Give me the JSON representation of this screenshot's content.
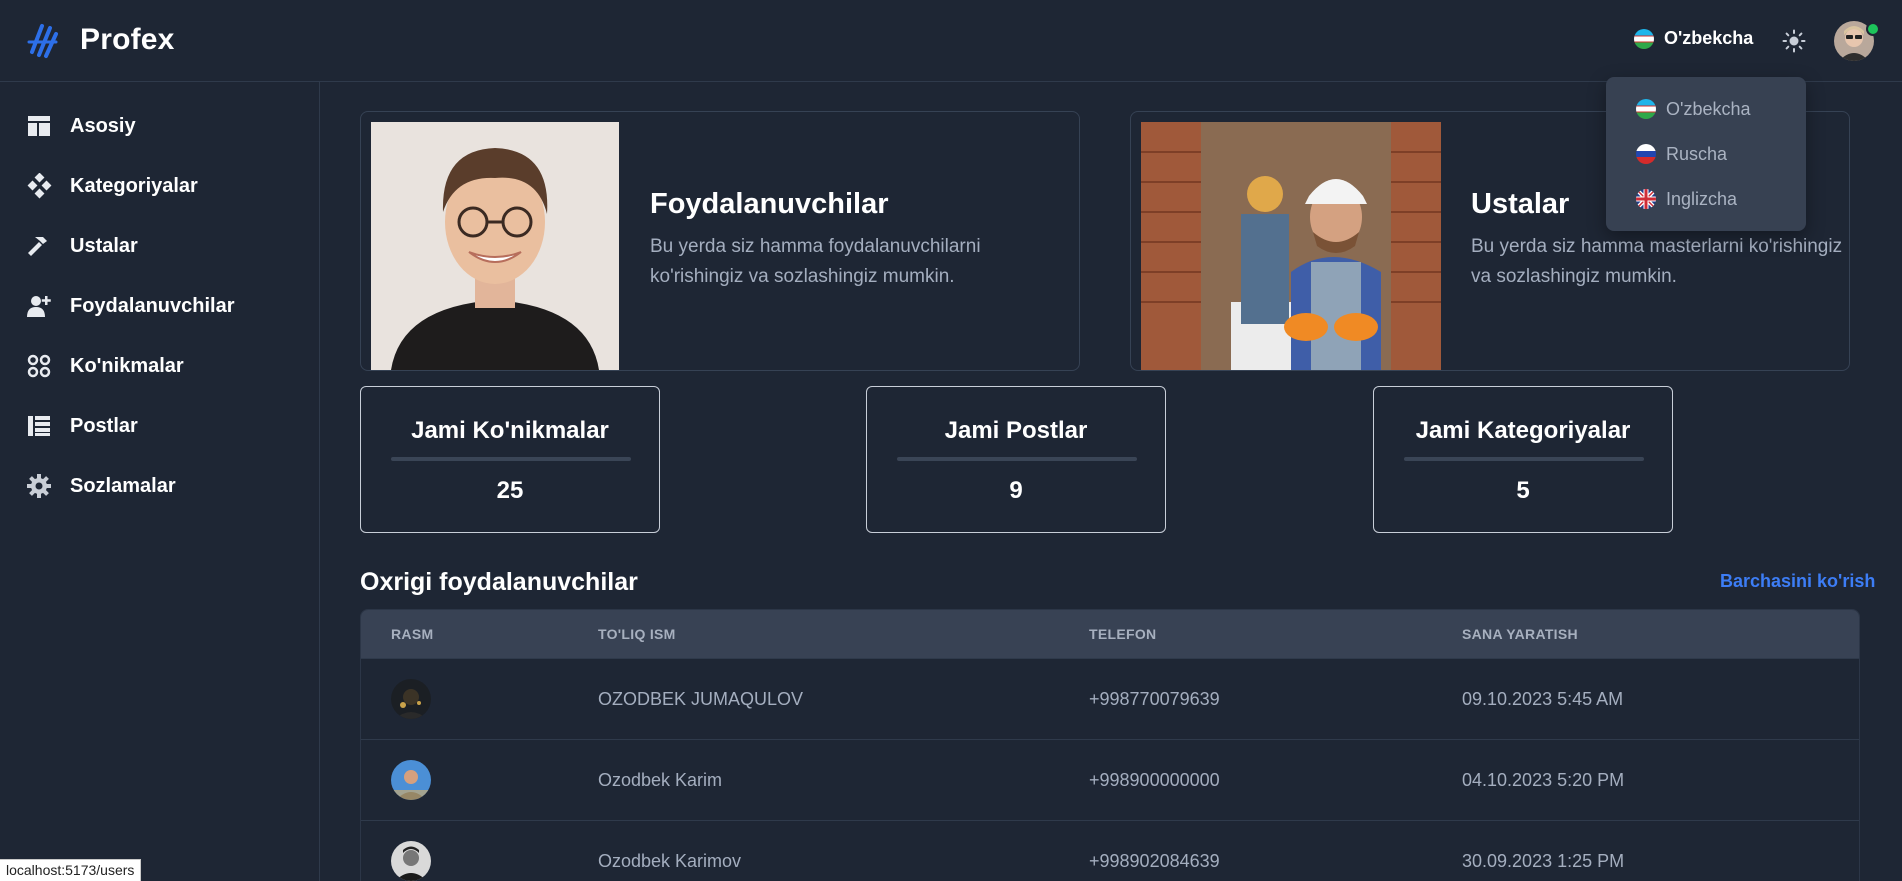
{
  "brand": {
    "name": "Profex",
    "logo_icon": "profex-logo-icon"
  },
  "header": {
    "language_current": "O'zbekcha",
    "theme_icon": "sun-icon",
    "user_avatar": "user-avatar",
    "online_color": "#1dc45a"
  },
  "language_menu": {
    "options": [
      {
        "label": "O'zbekcha",
        "flag": "uzbekistan-flag-icon"
      },
      {
        "label": "Ruscha",
        "flag": "russia-flag-icon"
      },
      {
        "label": "Inglizcha",
        "flag": "uk-flag-icon"
      }
    ]
  },
  "sidebar": {
    "items": [
      {
        "label": "Asosiy",
        "icon": "dashboard-icon"
      },
      {
        "label": "Kategoriyalar",
        "icon": "categories-icon"
      },
      {
        "label": "Ustalar",
        "icon": "hammer-icon"
      },
      {
        "label": "Foydalanuvchilar",
        "icon": "user-add-icon"
      },
      {
        "label": "Ko'nikmalar",
        "icon": "skills-icon"
      },
      {
        "label": "Postlar",
        "icon": "list-icon"
      },
      {
        "label": "Sozlamalar",
        "icon": "gear-icon"
      }
    ]
  },
  "hero_cards": [
    {
      "title": "Foydalanuvchilar",
      "description": "Bu yerda siz hamma foydalanuvchilarni ko'rishingiz va sozlashingiz mumkin."
    },
    {
      "title": "Ustalar",
      "description": "Bu yerda siz hamma masterlarni ko'rishingiz va sozlashingiz mumkin."
    }
  ],
  "stats": [
    {
      "title": "Jami Ko'nikmalar",
      "value": "25"
    },
    {
      "title": "Jami Postlar",
      "value": "9"
    },
    {
      "title": "Jami Kategoriyalar",
      "value": "5"
    }
  ],
  "recent_users": {
    "title": "Oxrigi foydalanuvchilar",
    "see_all": "Barchasini ko'rish",
    "columns": [
      "RASM",
      "TO'LIQ ISM",
      "TELEFON",
      "SANA YARATISH"
    ],
    "rows": [
      {
        "name": "OZODBEK JUMAQULOV",
        "phone": "+998770079639",
        "created": "09.10.2023 5:45 AM"
      },
      {
        "name": "Ozodbek Karim",
        "phone": "+998900000000",
        "created": "04.10.2023 5:20 PM"
      },
      {
        "name": "Ozodbek Karimov",
        "phone": "+998902084639",
        "created": "30.09.2023 1:25 PM"
      }
    ]
  },
  "status_bar": {
    "url": "localhost:5173/users"
  },
  "colors": {
    "background": "#1e2634",
    "accent_link": "#3d7df5",
    "muted_text": "#a4aebf",
    "table_header": "#384254",
    "dropdown_bg": "#374152"
  }
}
